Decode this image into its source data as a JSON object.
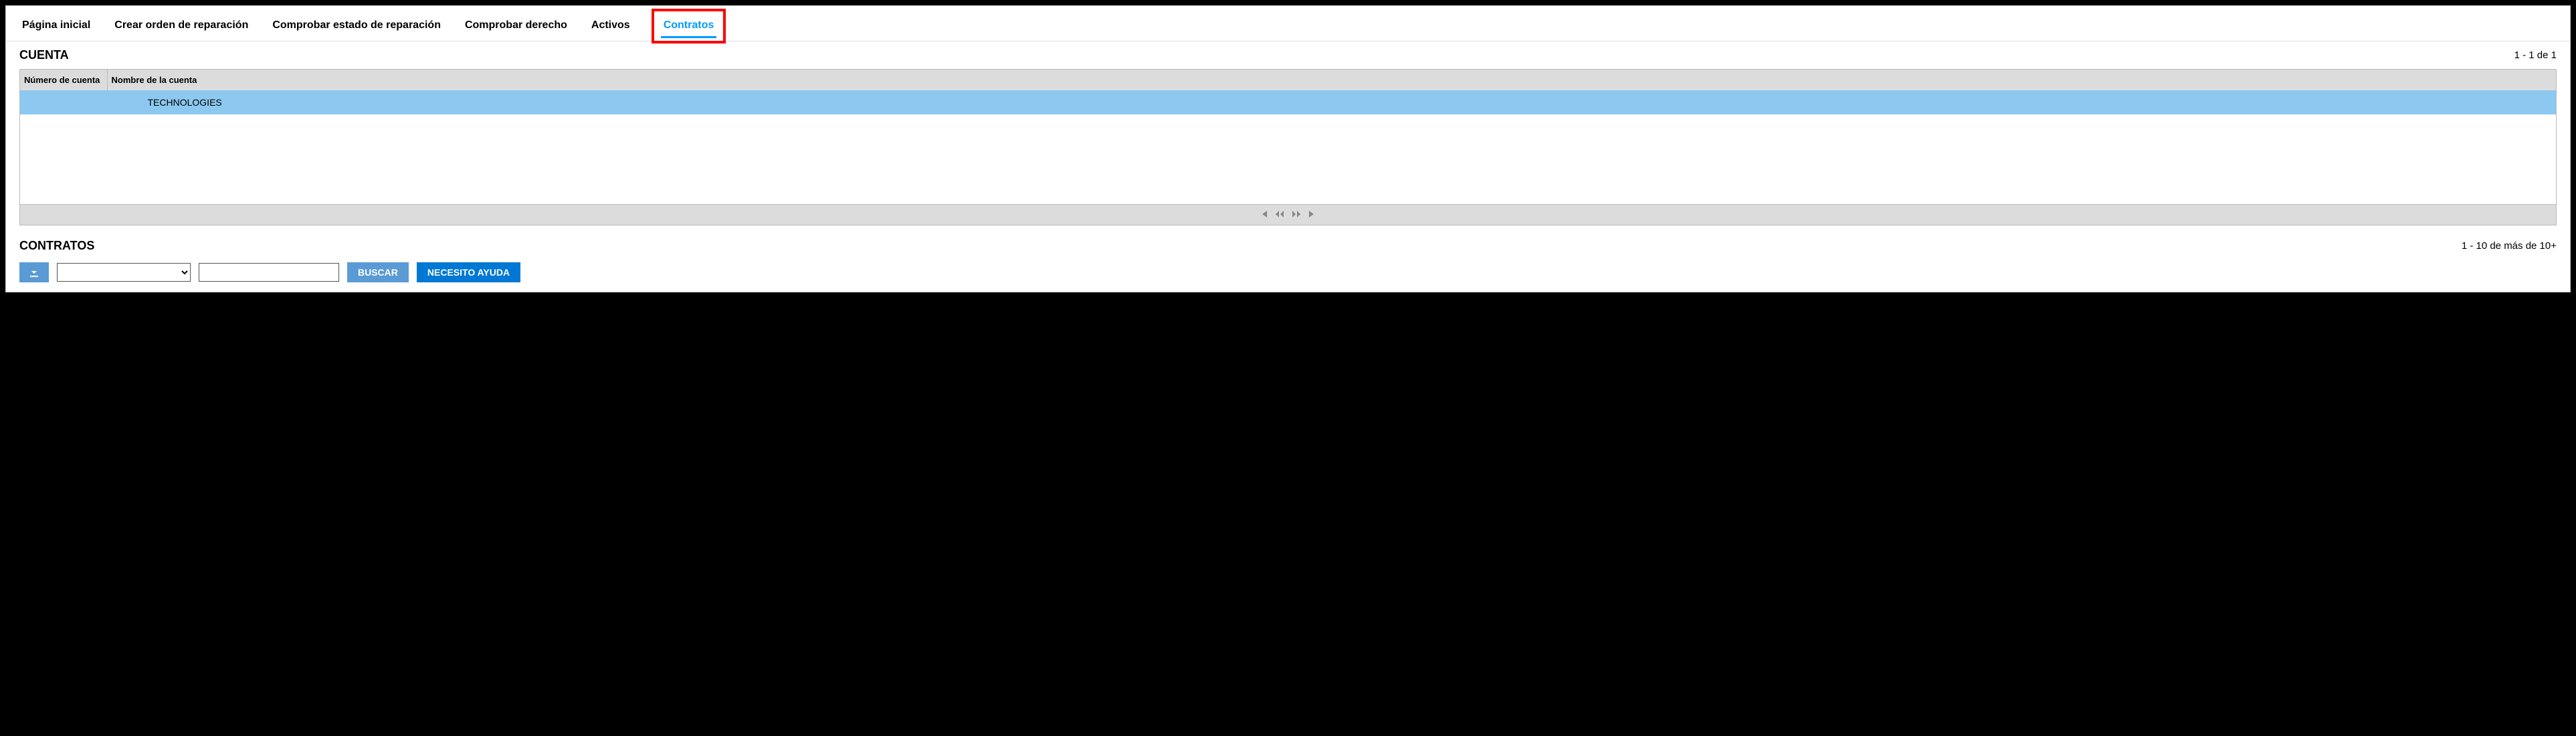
{
  "tabs": {
    "items": [
      {
        "label": "Página inicial",
        "active": false
      },
      {
        "label": "Crear orden de reparación",
        "active": false
      },
      {
        "label": "Comprobar estado de reparación",
        "active": false
      },
      {
        "label": "Comprobar derecho",
        "active": false
      },
      {
        "label": "Activos",
        "active": false
      },
      {
        "label": "Contratos",
        "active": true,
        "highlighted": true
      }
    ]
  },
  "account": {
    "title": "CUENTA",
    "range": "1 - 1 de 1",
    "columns": {
      "number": "Número de cuenta",
      "name": "Nombre de la cuenta"
    },
    "rows": [
      {
        "number": "",
        "name": "TECHNOLOGIES",
        "selected": true
      }
    ]
  },
  "contracts": {
    "title": "CONTRATOS",
    "range": "1 - 10 de más de 10+",
    "toolbar": {
      "download_icon": "download-icon",
      "filter_select_value": "",
      "filter_text_value": "",
      "search_label": "BUSCAR",
      "help_label": "NECESITO AYUDA"
    }
  },
  "pager_icons": {
    "first": "⏮",
    "prev": "◀◀",
    "next": "▶▶",
    "last": "⏭"
  }
}
